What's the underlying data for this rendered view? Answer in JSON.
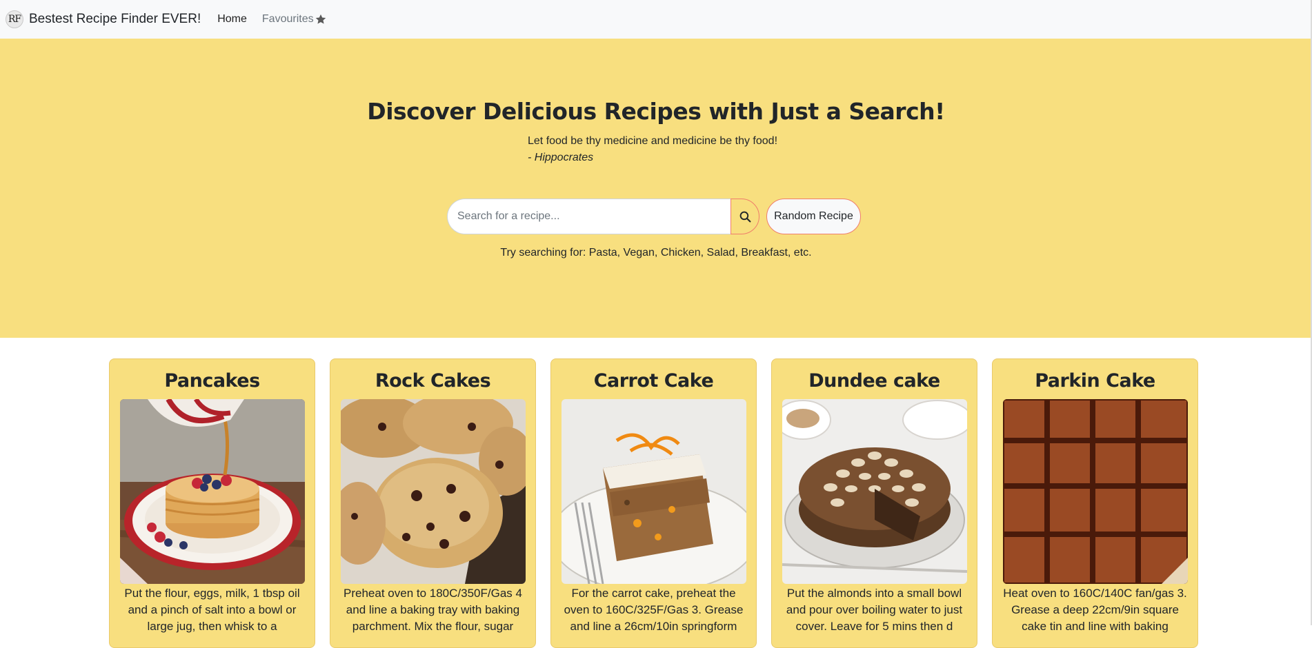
{
  "navbar": {
    "logo_text": "RF",
    "brand": "Bestest Recipe Finder EVER!",
    "home": "Home",
    "favourites": "Favourites",
    "favourites_icon": "star-icon"
  },
  "hero": {
    "title": "Discover Delicious Recipes with Just a Search!",
    "quote": "Let food be thy medicine and medicine be thy food!",
    "quote_author": "- Hippocrates",
    "search_placeholder": "Search for a recipe...",
    "search_icon": "search-icon",
    "random_button": "Random Recipe",
    "suggestions": "Try searching for: Pasta, Vegan, Chicken, Salad, Breakfast, etc."
  },
  "colors": {
    "hero_background": "#f8df7f",
    "navbar_background": "#f8f9fa",
    "button_border": "#ef7d6a"
  },
  "recipes": [
    {
      "title": "Pancakes",
      "image": "pancakes-photo",
      "text": "Put the flour, eggs, milk, 1 tbsp oil and a pinch of salt into a bowl or large jug, then whisk to a"
    },
    {
      "title": "Rock Cakes",
      "image": "rock-cakes-photo",
      "text": "Preheat oven to 180C/350F/Gas 4 and line a baking tray with baking parchment. Mix the flour, sugar"
    },
    {
      "title": "Carrot Cake",
      "image": "carrot-cake-photo",
      "text": "For the carrot cake, preheat the oven to 160C/325F/Gas 3. Grease and line a 26cm/10in springform"
    },
    {
      "title": "Dundee cake",
      "image": "dundee-cake-photo",
      "text": "Put the almonds into a small bowl and pour over boiling water to just cover. Leave for 5 mins then d"
    },
    {
      "title": "Parkin Cake",
      "image": "parkin-cake-photo",
      "text": "Heat oven to 160C/140C fan/gas 3. Grease a deep 22cm/9in square cake tin and line with baking"
    }
  ]
}
